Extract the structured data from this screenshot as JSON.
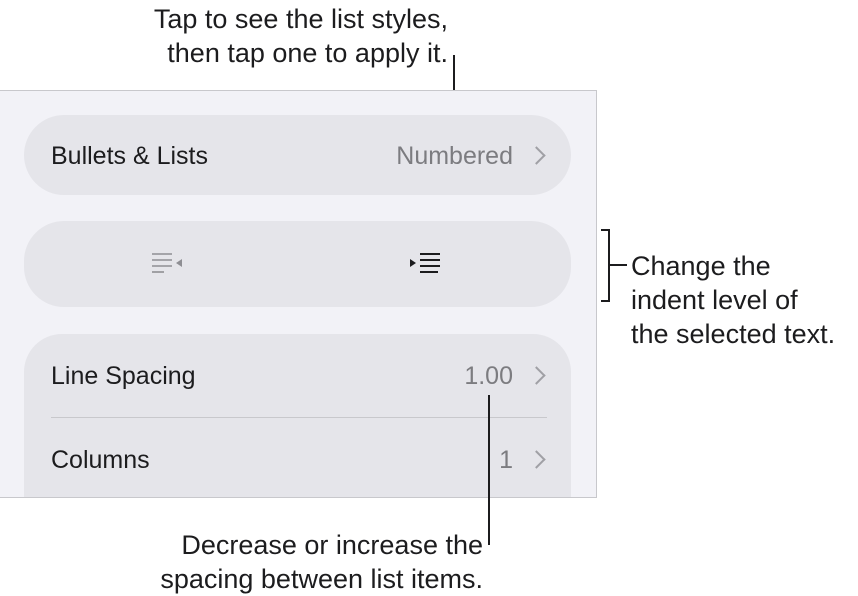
{
  "callouts": {
    "top": [
      "Tap to see the list styles,",
      "then tap one to apply it."
    ],
    "right": [
      "Change the",
      "indent level of",
      "the selected text."
    ],
    "bottom": [
      "Decrease or increase the",
      "spacing between list items."
    ]
  },
  "bullets_lists": {
    "label": "Bullets & Lists",
    "value": "Numbered"
  },
  "indent": {
    "decrease_icon": "decrease-indent-icon",
    "increase_icon": "increase-indent-icon"
  },
  "line_spacing": {
    "label": "Line Spacing",
    "value": "1.00"
  },
  "columns": {
    "label": "Columns",
    "value": "1"
  },
  "colors": {
    "panel_bg": "#f2f2f7",
    "row_bg": "#e5e5ea",
    "value_text": "#7c7c80"
  }
}
